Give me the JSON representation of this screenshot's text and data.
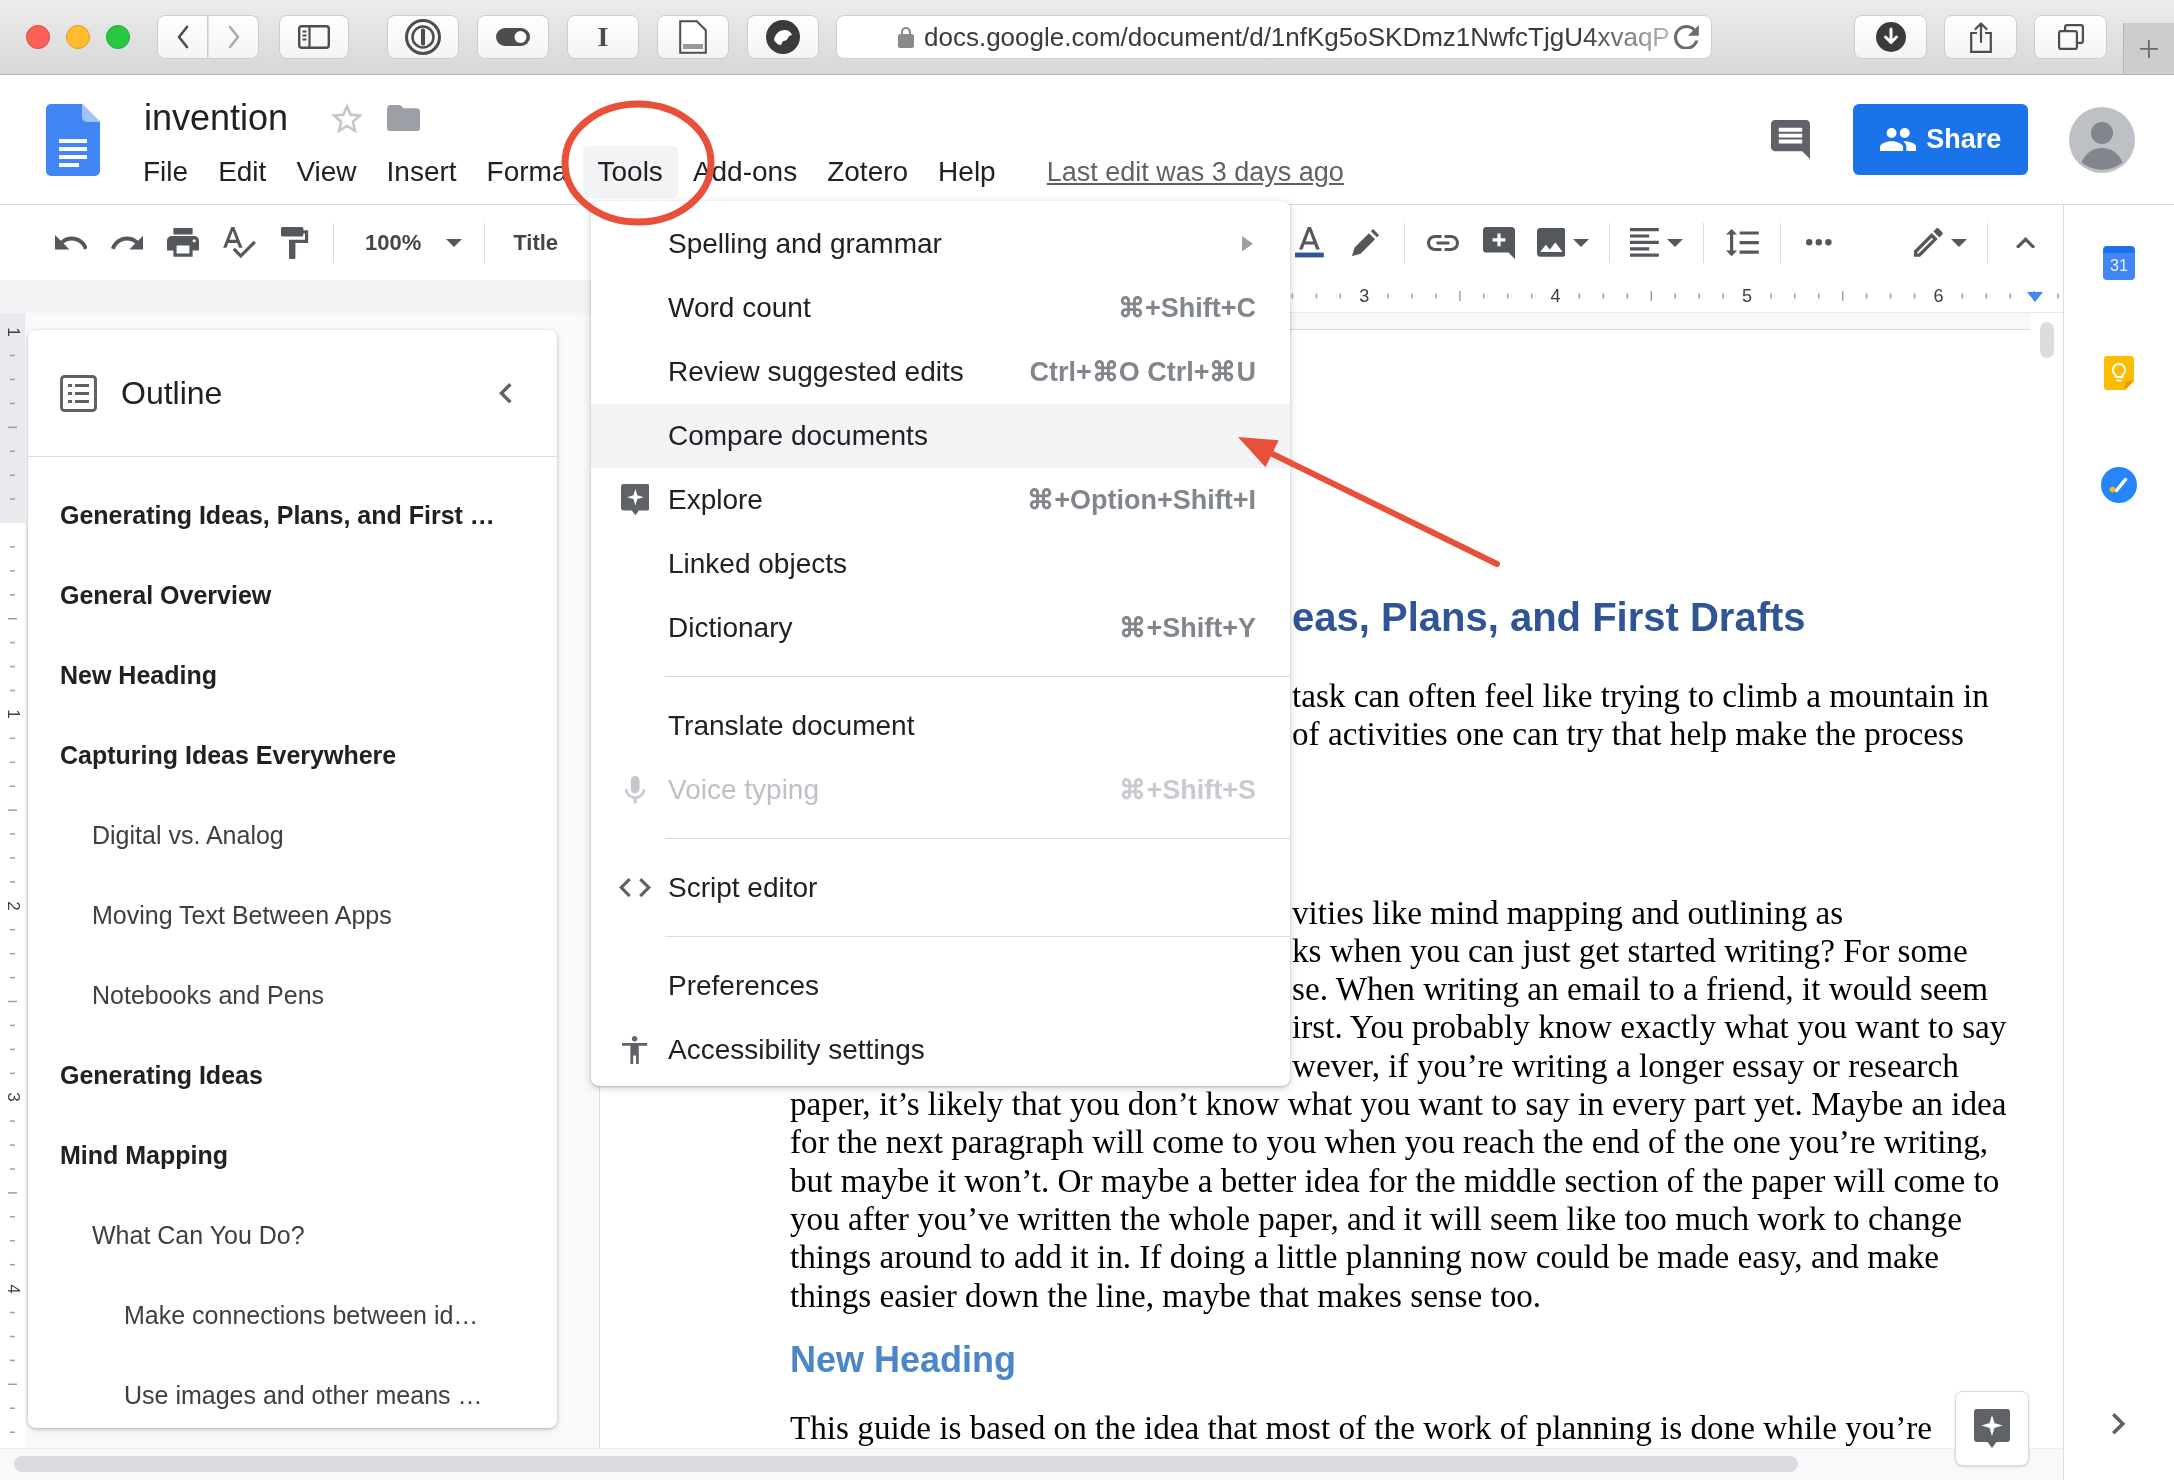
{
  "browser": {
    "url": "docs.google.com/document/d/1nfKg5oSKDmz1NwfcTjgU4xvaqP",
    "extension_letter": "I"
  },
  "doc_header": {
    "title": "invention",
    "starred": false,
    "menus": [
      {
        "label": "File",
        "selected": false
      },
      {
        "label": "Edit",
        "selected": false
      },
      {
        "label": "View",
        "selected": false
      },
      {
        "label": "Insert",
        "selected": false
      },
      {
        "label": "Forma",
        "selected": false
      },
      {
        "label": "Tools",
        "selected": true
      },
      {
        "label": "Add-ons",
        "selected": false
      },
      {
        "label": "Zotero",
        "selected": false
      },
      {
        "label": "Help",
        "selected": false
      }
    ],
    "last_edit": "Last edit was 3 days ago",
    "share_button": "Share"
  },
  "toolbar": {
    "zoom": "100%",
    "paragraph_style": "Title"
  },
  "rulers": {
    "top_labels": [
      "3",
      "4",
      "5",
      "6"
    ],
    "left_labels": [
      "1",
      "1",
      "2",
      "3",
      "4"
    ]
  },
  "outline": {
    "title": "Outline",
    "items": [
      {
        "label": "Generating Ideas, Plans, and First …"
      },
      {
        "label": "General Overview"
      },
      {
        "label": "New Heading"
      },
      {
        "label": "Capturing Ideas Everywhere",
        "children": [
          {
            "label": "Digital vs. Analog"
          },
          {
            "label": "Moving Text Between Apps"
          },
          {
            "label": "Notebooks and Pens"
          }
        ]
      },
      {
        "label": "Generating Ideas"
      },
      {
        "label": "Mind Mapping",
        "children": [
          {
            "label": "What Can You Do?",
            "children": [
              {
                "label": "Make connections between id…"
              },
              {
                "label": "Use images and other means …"
              }
            ]
          }
        ]
      }
    ]
  },
  "tools_menu": {
    "items": [
      {
        "kind": "item",
        "label": "Spelling and grammar",
        "submenu": true,
        "selected": false,
        "disabled": false
      },
      {
        "kind": "item",
        "label": "Word count",
        "shortcut": "⌘+Shift+C",
        "submenu": false,
        "selected": false,
        "disabled": false
      },
      {
        "kind": "item",
        "label": "Review suggested edits",
        "shortcut": "Ctrl+⌘O Ctrl+⌘U",
        "submenu": false,
        "selected": false,
        "disabled": false
      },
      {
        "kind": "item",
        "label": "Compare documents",
        "submenu": false,
        "selected": true,
        "disabled": false
      },
      {
        "kind": "item",
        "label": "Explore",
        "shortcut": "⌘+Option+Shift+I",
        "submenu": false,
        "selected": false,
        "disabled": false
      },
      {
        "kind": "item",
        "label": "Linked objects",
        "submenu": false,
        "selected": false,
        "disabled": false
      },
      {
        "kind": "item",
        "label": "Dictionary",
        "shortcut": "⌘+Shift+Y",
        "submenu": false,
        "selected": false,
        "disabled": false
      },
      {
        "kind": "divider"
      },
      {
        "kind": "item",
        "label": "Translate document",
        "submenu": false,
        "selected": false,
        "disabled": false
      },
      {
        "kind": "item",
        "label": "Voice typing",
        "shortcut": "⌘+Shift+S",
        "submenu": false,
        "selected": false,
        "disabled": true
      },
      {
        "kind": "divider"
      },
      {
        "kind": "item",
        "label": "Script editor",
        "submenu": false,
        "selected": false,
        "disabled": false
      },
      {
        "kind": "divider"
      },
      {
        "kind": "item",
        "label": "Preferences",
        "submenu": false,
        "selected": false,
        "disabled": false
      },
      {
        "kind": "item",
        "label": "Accessibility settings",
        "submenu": false,
        "selected": false,
        "disabled": false
      }
    ]
  },
  "page": {
    "heading": "eas, Plans, and First Drafts",
    "paragraphs": [
      {
        "lines": [
          "task can often feel like trying to climb a mountain in",
          "of activities one can try that help make the process"
        ]
      },
      {
        "lines": [
          "vities like mind mapping and outlining as",
          "ks when you can just get started writing? For some",
          "se. When writing an email to a friend, it would seem",
          "irst. You probably know exactly what you want to say",
          "wever, if you’re writing a longer essay or research",
          "paper, it’s likely that you don’t know what you want to say in every part yet. Maybe an idea",
          "for the next paragraph will come to you when you reach the end of the one you’re writing,",
          "but maybe it won’t. Or maybe a better idea for the middle section of the paper will come to",
          "you after you’ve written the whole paper, and it will seem like too much work to change",
          "things around to add it in. If doing a little planning now could be made easy, and make",
          "things easier down the line, maybe that makes sense too."
        ]
      }
    ],
    "subheading": "New Heading",
    "last_line": "This guide is based on the idea that most of the work of planning is done while you’re"
  },
  "side_panel": {
    "calendar_day": "31"
  }
}
